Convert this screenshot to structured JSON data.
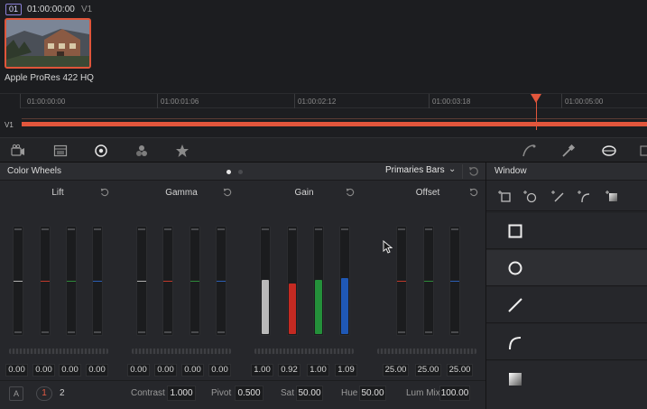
{
  "clip": {
    "number": "01",
    "timecode": "01:00:00:00",
    "track": "V1",
    "codec": "Apple ProRes 422 HQ"
  },
  "timeline": {
    "ticks": [
      "01:00:00:00",
      "01:00:01:06",
      "01:00:02:12",
      "01:00:03:18",
      "01:00:05:00"
    ],
    "track_label": "V1",
    "accent_color": "#e2563c"
  },
  "toolbar": {
    "icons": [
      "camera-raw-icon",
      "color-match-icon",
      "color-wheels-icon",
      "rgb-mixer-icon",
      "motion-effects-icon",
      "curves-icon",
      "qualifier-icon",
      "window-icon"
    ]
  },
  "color_wheels": {
    "title": "Color Wheels",
    "mode": "Primaries Bars",
    "groups": [
      {
        "name": "Lift",
        "values": [
          "0.00",
          "0.00",
          "0.00",
          "0.00"
        ],
        "channels": [
          "Y",
          "R",
          "G",
          "B"
        ]
      },
      {
        "name": "Gamma",
        "values": [
          "0.00",
          "0.00",
          "0.00",
          "0.00"
        ],
        "channels": [
          "Y",
          "R",
          "G",
          "B"
        ]
      },
      {
        "name": "Gain",
        "values": [
          "1.00",
          "0.92",
          "1.00",
          "1.09"
        ],
        "channels": [
          "Y",
          "R",
          "G",
          "B"
        ]
      },
      {
        "name": "Offset",
        "values": [
          "25.00",
          "25.00",
          "25.00"
        ],
        "channels": [
          "R",
          "G",
          "B"
        ]
      }
    ],
    "footer": {
      "auto_label": "A",
      "page_1": "1",
      "page_2": "2",
      "contrast_label": "Contrast",
      "contrast_value": "1.000",
      "pivot_label": "Pivot",
      "pivot_value": "0.500",
      "sat_label": "Sat",
      "sat_value": "50.00",
      "hue_label": "Hue",
      "hue_value": "50.00",
      "lummix_label": "Lum Mix",
      "lummix_value": "100.00"
    }
  },
  "window_panel": {
    "title": "Window",
    "tools": [
      "add-rectangle-icon",
      "add-circle-icon",
      "add-linear-icon",
      "add-polygon-icon",
      "add-gradient-icon"
    ],
    "shapes": [
      "square-window-icon",
      "circle-window-icon",
      "linear-window-icon",
      "curve-window-icon",
      "gradient-window-icon"
    ]
  }
}
